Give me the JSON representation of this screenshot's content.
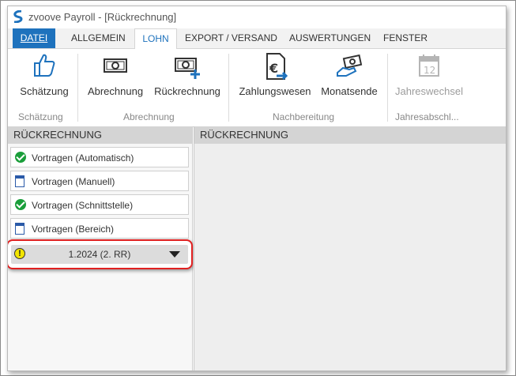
{
  "window": {
    "title": "zvoove Payroll - [Rückrechnung]"
  },
  "menu": {
    "items": [
      "DATEI",
      "ALLGEMEIN",
      "LOHN",
      "EXPORT / VERSAND",
      "AUSWERTUNGEN",
      "FENSTER"
    ],
    "active": "LOHN"
  },
  "ribbon": {
    "buttons": [
      {
        "label": "Schätzung",
        "icon": "thumbs-up-icon"
      },
      {
        "label": "Abrechnung",
        "icon": "banknote-icon"
      },
      {
        "label": "Rückrechnung",
        "icon": "banknote-plus-icon"
      },
      {
        "label": "Zahlungswesen",
        "icon": "euro-document-icon"
      },
      {
        "label": "Monatsende",
        "icon": "money-hand-icon"
      },
      {
        "label": "Jahreswechsel",
        "icon": "calendar-12-icon",
        "disabled": true
      }
    ],
    "groups": [
      "Schätzung",
      "Abrechnung",
      "Nachbereitung",
      "Jahresabschl..."
    ]
  },
  "left_panel": {
    "header": "RÜCKRECHNUNG",
    "items": [
      {
        "label": "Vortragen (Automatisch)",
        "icon": "check-circle-icon"
      },
      {
        "label": "Vortragen (Manuell)",
        "icon": "document-icon"
      },
      {
        "label": "Vortragen (Schnittstelle)",
        "icon": "check-circle-icon"
      },
      {
        "label": "Vortragen (Bereich)",
        "icon": "document-icon"
      }
    ],
    "selector": {
      "value": "1.2024 (2. RR)",
      "icon": "warning-icon"
    }
  },
  "right_panel": {
    "header": "RÜCKRECHNUNG"
  },
  "colors": {
    "accent": "#1e72bd",
    "highlight_border": "#e02020",
    "success": "#1a9e3a",
    "warning": "#f2e500"
  }
}
